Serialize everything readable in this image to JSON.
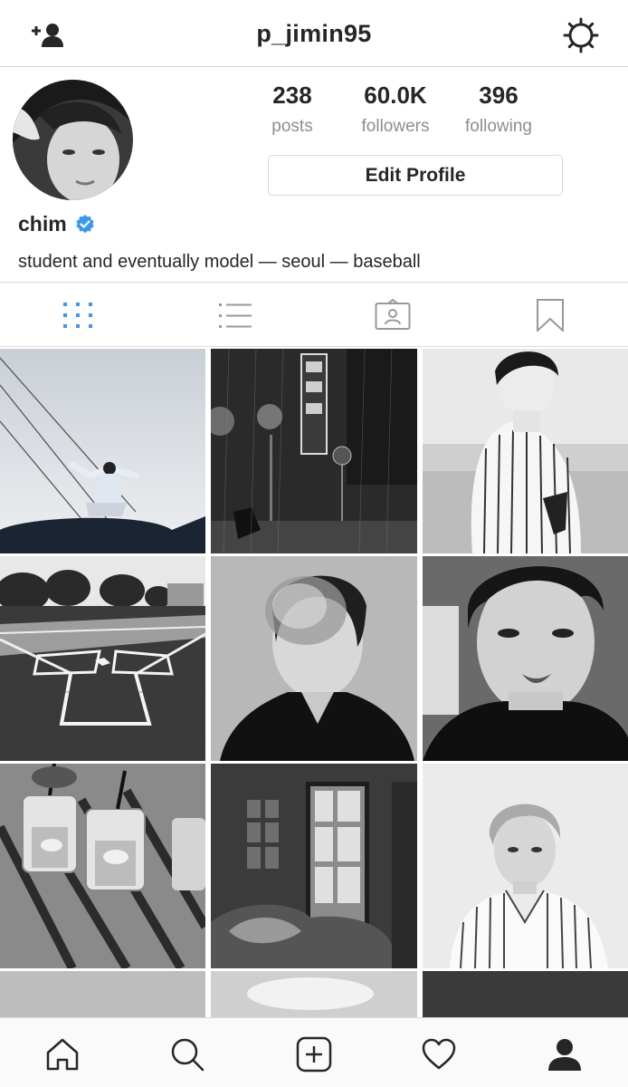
{
  "header": {
    "username": "p_jimin95",
    "left_icon": "add-user-icon",
    "right_icon": "settings-gear-icon"
  },
  "profile": {
    "stats": [
      {
        "value": "238",
        "label": "posts"
      },
      {
        "value": "60.0K",
        "label": "followers"
      },
      {
        "value": "396",
        "label": "following"
      }
    ],
    "edit_button": "Edit Profile",
    "display_name": "chim",
    "verified": true,
    "bio": "student and eventually model — seoul — baseball"
  },
  "tabs": [
    {
      "icon": "grid-icon",
      "active": true
    },
    {
      "icon": "list-icon",
      "active": false
    },
    {
      "icon": "tagged-icon",
      "active": false
    },
    {
      "icon": "saved-bookmark-icon",
      "active": false
    }
  ],
  "posts": [
    {
      "subject": "person on car roof, arms open, sky"
    },
    {
      "subject": "rainy night street with neon sign"
    },
    {
      "subject": "person in striped baseball jersey by sea"
    },
    {
      "subject": "baseball field home plate"
    },
    {
      "subject": "person exhaling smoke"
    },
    {
      "subject": "close-up portrait in dark shirt"
    },
    {
      "subject": "iced drinks on wooden picnic table"
    },
    {
      "subject": "window shadows over bed"
    },
    {
      "subject": "portrait in striped shirt"
    }
  ],
  "bottom_nav": [
    {
      "icon": "home-icon"
    },
    {
      "icon": "search-icon"
    },
    {
      "icon": "new-post-icon"
    },
    {
      "icon": "activity-heart-icon"
    },
    {
      "icon": "profile-icon",
      "active": true
    }
  ],
  "colors": {
    "accent_blue": "#3897f0",
    "border": "#dbdbdb",
    "muted_text": "#8e8e8e",
    "text": "#262626"
  }
}
